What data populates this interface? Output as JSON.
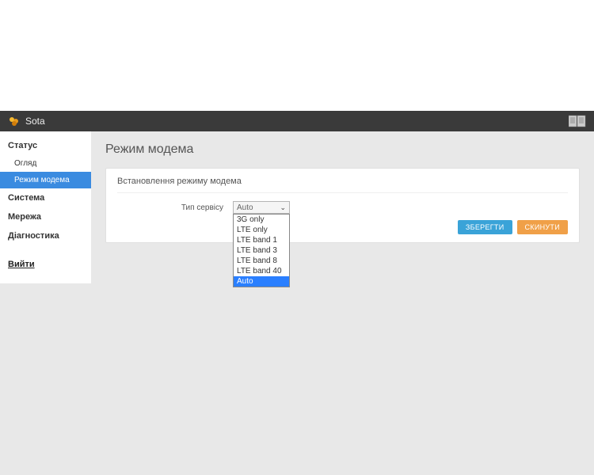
{
  "brand": {
    "name": "Sota"
  },
  "sidebar": {
    "items": [
      {
        "label": "Статус",
        "type": "group"
      },
      {
        "label": "Огляд",
        "type": "sub"
      },
      {
        "label": "Режим модема",
        "type": "sub",
        "active": true
      },
      {
        "label": "Система",
        "type": "group"
      },
      {
        "label": "Мережа",
        "type": "group"
      },
      {
        "label": "Діагностика",
        "type": "group"
      }
    ],
    "logout": "Вийти"
  },
  "page": {
    "title": "Режим модема",
    "panel_head": "Встановлення режиму модема",
    "service_type_label": "Тип сервісу",
    "selected_value": "Auto",
    "options": [
      "3G only",
      "LTE only",
      "LTE band 1",
      "LTE band 3",
      "LTE band 8",
      "LTE band 40",
      "Auto"
    ],
    "save_label": "ЗБЕРЕГТИ",
    "reset_label": "СКИНУТИ"
  }
}
